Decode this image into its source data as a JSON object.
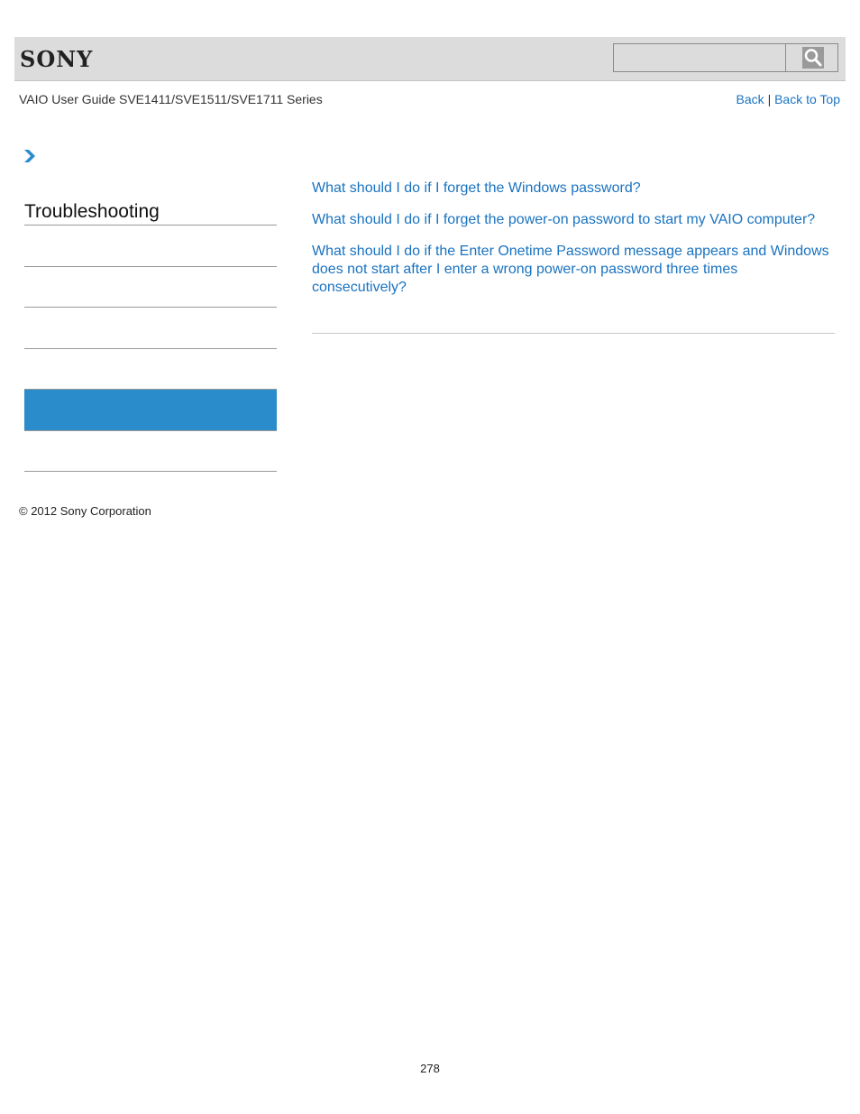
{
  "header": {
    "logo": "SONY",
    "search": {
      "placeholder": "",
      "value": "",
      "button_icon": "search-icon"
    }
  },
  "guide_title": "VAIO User Guide SVE1411/SVE1511/SVE1711 Series",
  "top_links": {
    "back": "Back",
    "separator": "|",
    "back_to_top": "Back to Top"
  },
  "breadcrumb": {
    "icon": "chevron-right-icon"
  },
  "sidebar": {
    "section_title": "Troubleshooting",
    "items": [
      {
        "label": "",
        "active": false
      },
      {
        "label": "",
        "active": false
      },
      {
        "label": "",
        "active": false
      },
      {
        "label": "",
        "active": true
      },
      {
        "label": "",
        "active": false
      }
    ]
  },
  "main": {
    "links": [
      "What should I do if I forget the Windows password?",
      "What should I do if I forget the power-on password to start my VAIO computer?",
      "What should I do if the Enter Onetime Password message appears and Windows does not start after I enter a wrong power-on password three times consecutively?"
    ]
  },
  "colors": {
    "accent": "#2a8ccb",
    "link": "#1a73c0",
    "header_bg": "#dcdcdc"
  },
  "footer": {
    "copyright": "© 2012 Sony Corporation",
    "page_number": "278"
  }
}
